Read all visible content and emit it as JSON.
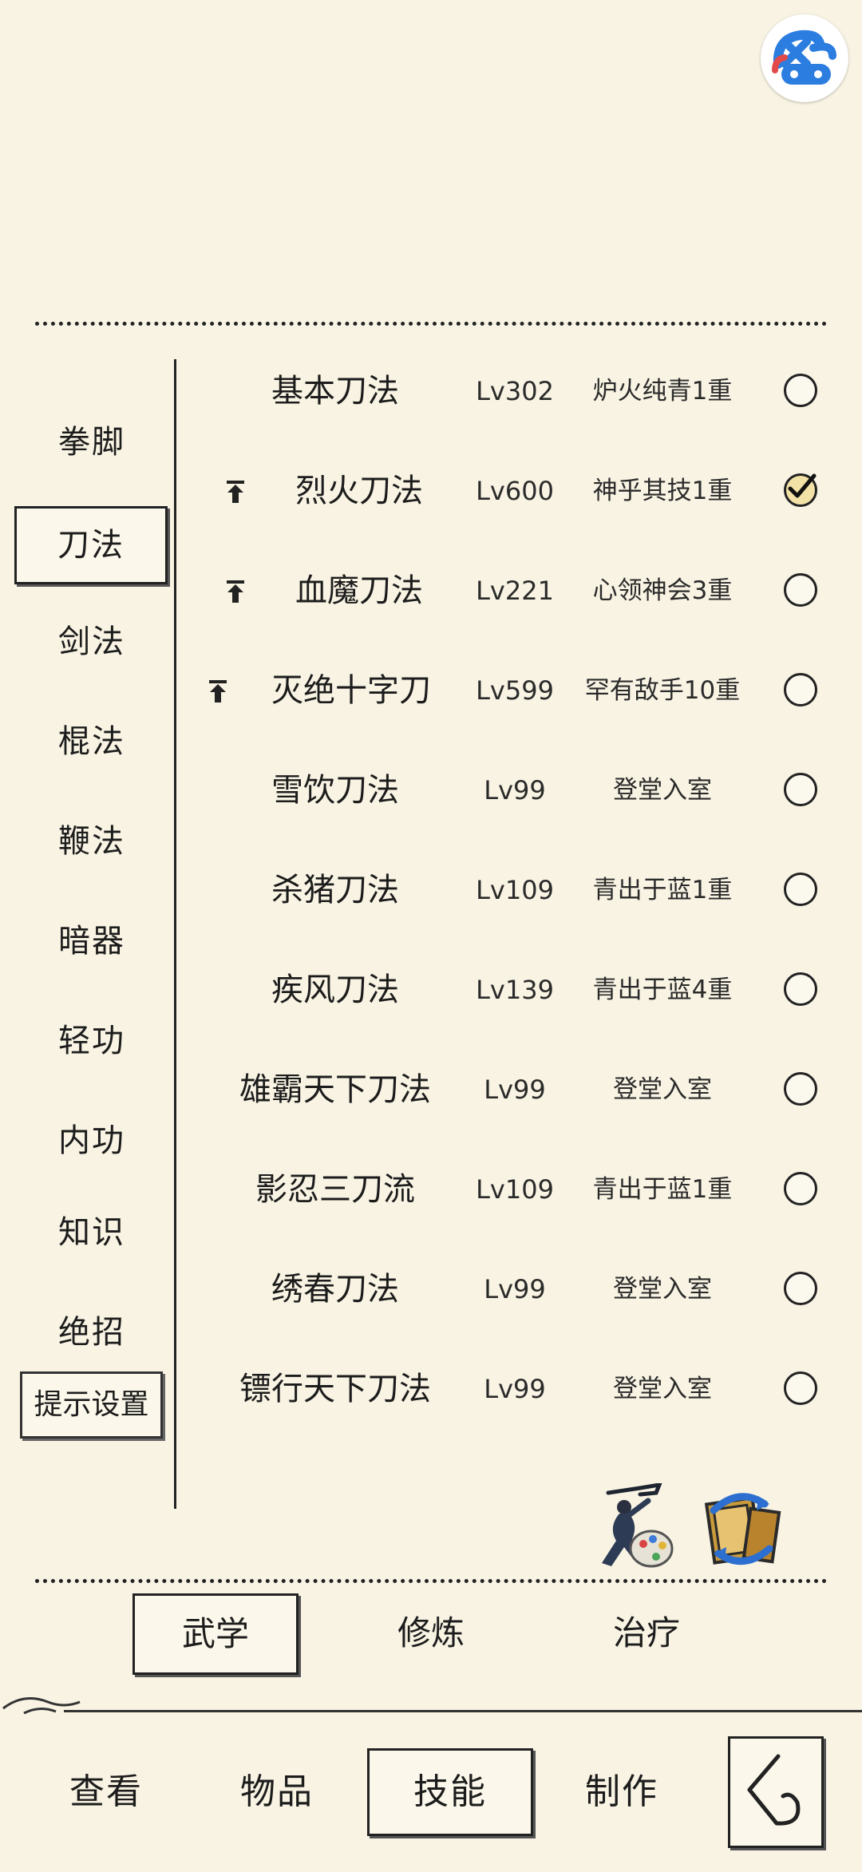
{
  "categories": [
    {
      "label": "拳脚"
    },
    {
      "label": "刀法"
    },
    {
      "label": "剑法"
    },
    {
      "label": "棍法"
    },
    {
      "label": "鞭法"
    },
    {
      "label": "暗器"
    },
    {
      "label": "轻功"
    },
    {
      "label": "内功"
    },
    {
      "label": "知识"
    },
    {
      "label": "绝招"
    }
  ],
  "selected_category": "刀法",
  "hint_settings_label": "提示设置",
  "skills": [
    {
      "name": "基本刀法",
      "level": "Lv302",
      "rank": "炉火纯青1重",
      "upgradable": false,
      "checked": false
    },
    {
      "name": "烈火刀法",
      "level": "Lv600",
      "rank": "神乎其技1重",
      "upgradable": true,
      "checked": true
    },
    {
      "name": "血魔刀法",
      "level": "Lv221",
      "rank": "心领神会3重",
      "upgradable": true,
      "checked": false
    },
    {
      "name": "灭绝十字刀",
      "level": "Lv599",
      "rank": "罕有敌手10重",
      "upgradable": true,
      "checked": false
    },
    {
      "name": "雪饮刀法",
      "level": "Lv99",
      "rank": "登堂入室",
      "upgradable": false,
      "checked": false
    },
    {
      "name": "杀猪刀法",
      "level": "Lv109",
      "rank": "青出于蓝1重",
      "upgradable": false,
      "checked": false
    },
    {
      "name": "疾风刀法",
      "level": "Lv139",
      "rank": "青出于蓝4重",
      "upgradable": false,
      "checked": false
    },
    {
      "name": "雄霸天下刀法",
      "level": "Lv99",
      "rank": "登堂入室",
      "upgradable": false,
      "checked": false
    },
    {
      "name": "影忍三刀流",
      "level": "Lv109",
      "rank": "青出于蓝1重",
      "upgradable": false,
      "checked": false
    },
    {
      "name": "绣春刀法",
      "level": "Lv99",
      "rank": "登堂入室",
      "upgradable": false,
      "checked": false
    },
    {
      "name": "镖行天下刀法",
      "level": "Lv99",
      "rank": "登堂入室",
      "upgradable": false,
      "checked": false
    }
  ],
  "action_icons": [
    "martial-artist-palette-icon",
    "book-exchange-icon"
  ],
  "sub_tabs": [
    {
      "label": "武学"
    },
    {
      "label": "修炼"
    },
    {
      "label": "治疗"
    }
  ],
  "selected_sub_tab": "武学",
  "nav": [
    {
      "label": "查看"
    },
    {
      "label": "物品"
    },
    {
      "label": "技能"
    },
    {
      "label": "制作"
    }
  ],
  "selected_nav": "技能",
  "colors": {
    "background": "#f8f3e3",
    "ink": "#1c1c1c",
    "checked_fill": "#f3e2a6"
  }
}
